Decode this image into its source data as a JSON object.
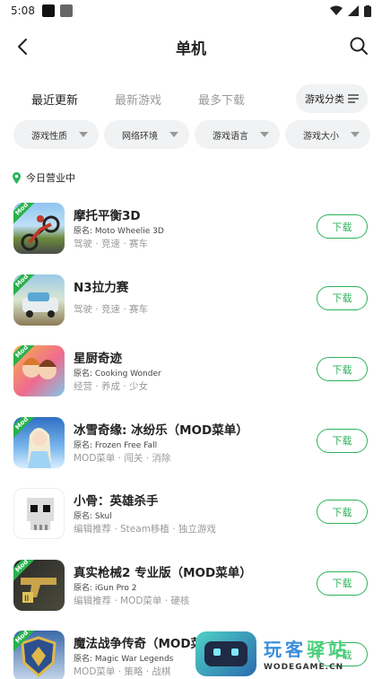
{
  "status_bar": {
    "time": "5:08"
  },
  "nav": {
    "title": "单机"
  },
  "tabs": [
    {
      "label": "最近更新",
      "active": true
    },
    {
      "label": "最新游戏",
      "active": false
    },
    {
      "label": "最多下载",
      "active": false
    }
  ],
  "category_button": {
    "label": "游戏分类"
  },
  "filters": [
    {
      "label": "游戏性质"
    },
    {
      "label": "网络环境"
    },
    {
      "label": "游戏语言"
    },
    {
      "label": "游戏大小"
    }
  ],
  "section": {
    "title": "今日营业中"
  },
  "download_label": "下载",
  "games": [
    {
      "name": "摩托平衡3D",
      "original": "原名: Moto Wheelie 3D",
      "tags": "驾驶 · 竞速 · 赛车",
      "thumb": "moto"
    },
    {
      "name": "N3拉力赛",
      "original": "",
      "tags": "驾驶 · 竞速 · 赛车",
      "thumb": "rally"
    },
    {
      "name": "星厨奇迹",
      "original": "原名: Cooking Wonder",
      "tags": "经营 · 养成 · 少女",
      "thumb": "cook"
    },
    {
      "name": "冰雪奇缘: 冰纷乐（MOD菜单）",
      "original": "原名: Frozen Free Fall",
      "tags": "MOD菜单 · 闯关 · 消除",
      "thumb": "frozen"
    },
    {
      "name": "小骨：英雄杀手",
      "original": "原名: Skul",
      "tags": "编辑推荐 · Steam移植 · 独立游戏",
      "thumb": "skul"
    },
    {
      "name": "真实枪械2 专业版（MOD菜单）",
      "original": "原名: iGun Pro 2",
      "tags": "编辑推荐 · MOD菜单 · 硬核",
      "thumb": "gun"
    },
    {
      "name": "魔法战争传奇（MOD菜单）",
      "original": "原名: Magic War Legends",
      "tags": "MOD菜单 · 策略 · 战棋",
      "thumb": "magic"
    }
  ],
  "mod_badge": "Mod",
  "watermark": {
    "cn_part1": "玩客",
    "cn_part2": "驿站",
    "en": "WODEGAME.CN"
  },
  "colors": {
    "accent": "#2bb35a",
    "chip_bg": "#f1f2f3",
    "muted": "#999999"
  }
}
